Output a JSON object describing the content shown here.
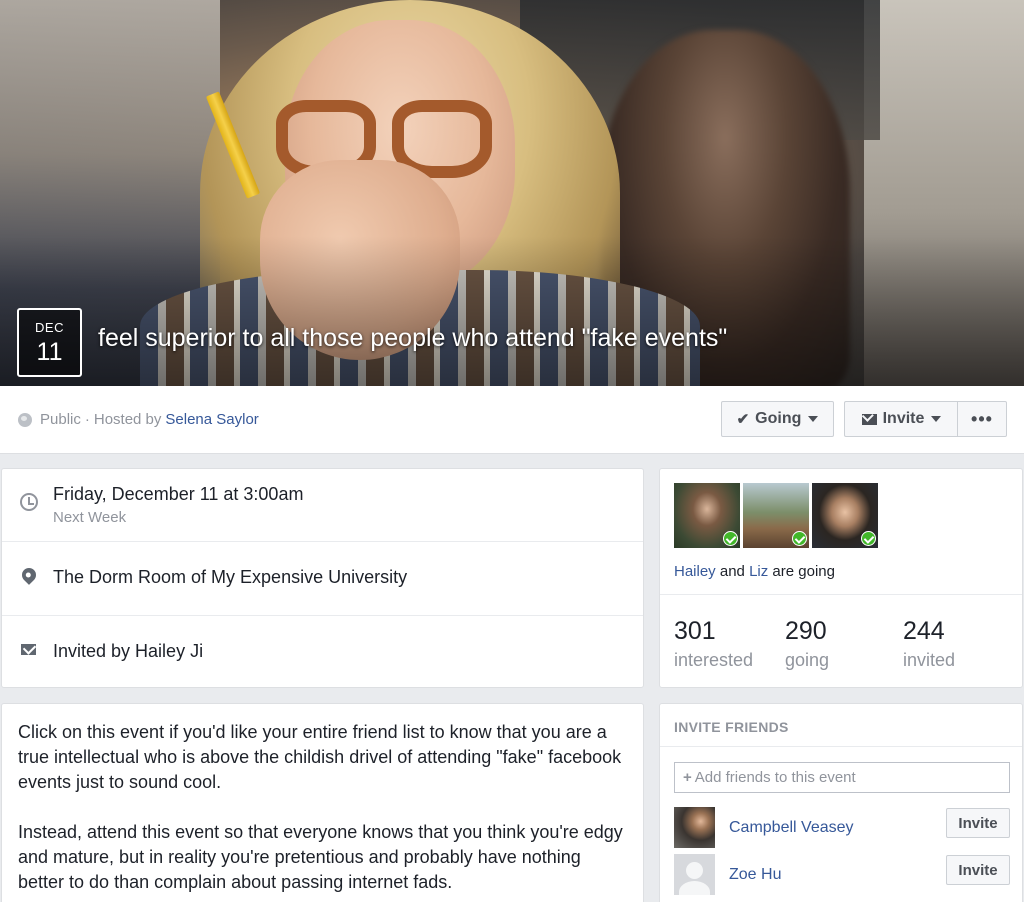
{
  "cover": {
    "date_month": "DEC",
    "date_day": "11",
    "title": "feel superior to all those people who attend \"fake events\""
  },
  "header": {
    "privacy": "Public",
    "hosted_by_prefix": "Hosted by",
    "host": "Selena Saylor",
    "going_label": "Going",
    "invite_label": "Invite",
    "more_label": "•••"
  },
  "details": {
    "date": "Friday, December 11 at 3:00am",
    "date_relative": "Next Week",
    "location": "The Dorm Room of My Expensive University",
    "invited_by": "Invited by Hailey Ji"
  },
  "description": {
    "paragraphs": [
      "Click on this event if you'd like your entire friend list to know that you are a true intellectual who is above the childish drivel of attending \"fake\" facebook events just to sound cool.",
      "Instead, attend this event so that everyone knows that you think you're edgy and mature, but in reality you're pretentious and probably have nothing better to do than complain about passing internet fads."
    ]
  },
  "guests": {
    "friend1": "Hailey",
    "and": "and",
    "friend2": "Liz",
    "going_suffix": "are going",
    "stats": [
      {
        "num": "301",
        "label": "interested"
      },
      {
        "num": "290",
        "label": "going"
      },
      {
        "num": "244",
        "label": "invited"
      }
    ]
  },
  "invite_friends": {
    "title": "INVITE FRIENDS",
    "placeholder": "Add friends to this event",
    "friends": [
      {
        "name": "Campbell Veasey",
        "button": "Invite"
      },
      {
        "name": "Zoe Hu",
        "button": "Invite"
      }
    ]
  }
}
